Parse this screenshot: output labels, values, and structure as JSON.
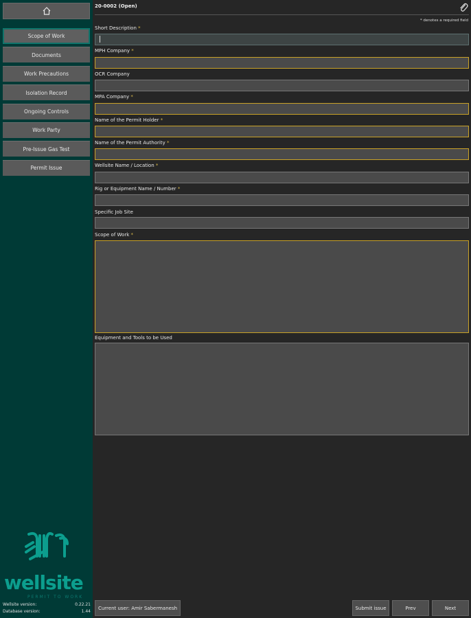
{
  "sidebar": {
    "home_icon": "home-icon",
    "items": [
      {
        "label": "Scope of Work",
        "active": true
      },
      {
        "label": "Documents"
      },
      {
        "label": "Work Precautions"
      },
      {
        "label": "Isolation Record"
      },
      {
        "label": "Ongoing Controls"
      },
      {
        "label": "Work Party"
      },
      {
        "label": "Pre-Issue Gas Test"
      },
      {
        "label": "Permit Issue"
      }
    ],
    "logo_text": "wellsite",
    "logo_tagline": "PERMIT TO WORK",
    "wellsite_version_label": "Wellsite version:",
    "wellsite_version_value": "0.22.21",
    "database_version_label": "Database version:",
    "database_version_value": "1.44"
  },
  "header": {
    "permit_title": "20-0002 (Open)",
    "attach_icon": "paperclip-icon",
    "required_note": "* denotes a required field"
  },
  "form": {
    "short_description": {
      "label": "Short Description",
      "value": ""
    },
    "mph_company": {
      "label": "MPH Company",
      "value": ""
    },
    "ocr_company": {
      "label": "OCR Company",
      "value": ""
    },
    "mpa_company": {
      "label": "MPA Company",
      "value": ""
    },
    "permit_holder": {
      "label": "Name of the Permit Holder",
      "value": ""
    },
    "permit_authority": {
      "label": "Name of the Permit Authority",
      "value": ""
    },
    "wellsite_name": {
      "label": "Wellsite Name / Location",
      "value": ""
    },
    "rig_equipment": {
      "label": "Rig or Equipment Name / Number",
      "value": ""
    },
    "specific_job_site": {
      "label": "Specific Job Site",
      "value": ""
    },
    "scope_of_work": {
      "label": "Scope of Work",
      "value": ""
    },
    "equipment_tools": {
      "label": "Equipment and Tools to be Used",
      "value": ""
    },
    "required_marker": "*"
  },
  "footer": {
    "current_user": "Current user: Amir Sabermanesh",
    "submit_label": "Submit issue",
    "prev_label": "Prev",
    "next_label": "Next"
  },
  "colors": {
    "sidebar_bg": "#003a36",
    "main_bg": "#262626",
    "required_border": "#c9a227",
    "accent": "#0c9e8e"
  }
}
